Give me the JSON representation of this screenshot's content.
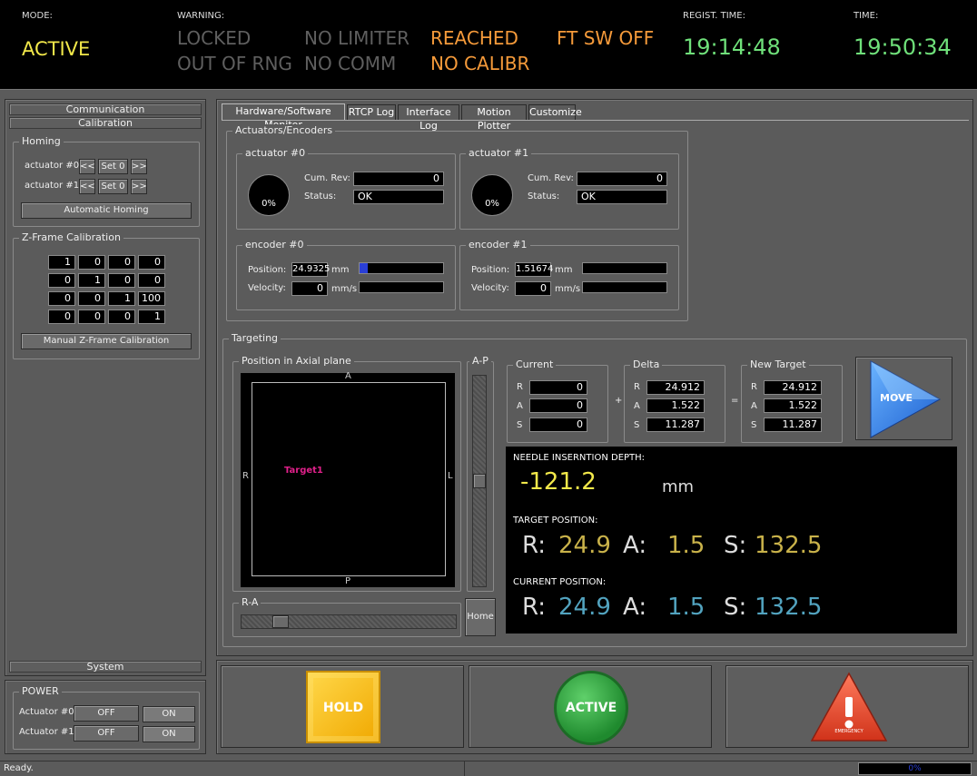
{
  "status": {
    "mode_label": "MODE:",
    "mode_value": "ACTIVE",
    "warning_label": "WARNING:",
    "warnings": {
      "locked": "LOCKED",
      "no_limiter": "NO LIMITER",
      "reached": "REACHED",
      "ft_sw_off": "FT SW OFF",
      "out_of_rng": "OUT OF RNG",
      "no_comm": "NO COMM",
      "no_calibr": "NO CALIBR"
    },
    "regist_label": "REGIST. TIME:",
    "regist_time": "19:14:48",
    "time_label": "TIME:",
    "time_value": "19:50:34"
  },
  "sidebar": {
    "communication": "Communication",
    "calibration": "Calibration",
    "homing_title": "Homing",
    "actuator0": "actuator #0",
    "actuator1": "actuator #1",
    "prev": "<<",
    "set0": "Set 0",
    "next": ">>",
    "auto_homing": "Automatic Homing",
    "zframe_title": "Z-Frame Calibration",
    "matrix": [
      [
        "1",
        "0",
        "0",
        "0"
      ],
      [
        "0",
        "1",
        "0",
        "0"
      ],
      [
        "0",
        "0",
        "1",
        "100"
      ],
      [
        "0",
        "0",
        "0",
        "1"
      ]
    ],
    "manual_zframe": "Manual Z-Frame Calibration",
    "system": "System"
  },
  "power": {
    "title": "POWER",
    "actuator0": "Actuator #0",
    "actuator1": "Actuator #1",
    "off": "OFF",
    "on": "ON"
  },
  "tabs": [
    "Hardware/Software Monitor",
    "RTCP Log",
    "Interface Log",
    "Motion Plotter",
    "Customize"
  ],
  "monitor": {
    "group_title": "Actuators/Encoders",
    "actuator0_title": "actuator #0",
    "actuator1_title": "actuator #1",
    "cum_rev_label": "Cum. Rev:",
    "status_label": "Status:",
    "dial0": "0%",
    "dial1": "0%",
    "cum_rev0": "0",
    "cum_rev1": "0",
    "status0": "OK",
    "status1": "OK",
    "encoder0_title": "encoder #0",
    "encoder1_title": "encoder #1",
    "position_label": "Position:",
    "velocity_label": "Velocity:",
    "mm": "mm",
    "mms": "mm/s",
    "pos0": "24.9325",
    "vel0": "0",
    "pos1": "1.51674",
    "vel1": "0",
    "pos0_bar_fraction": 0.1
  },
  "targeting": {
    "title": "Targeting",
    "axial_title": "Position in Axial plane",
    "ap_title": "A-P",
    "ra_title": "R-A",
    "label_a": "A",
    "label_p": "P",
    "label_r": "R",
    "label_l": "L",
    "target_label": "Target1",
    "home": "Home",
    "current_title": "Current",
    "delta_title": "Delta",
    "new_target_title": "New Target",
    "r": "R",
    "a": "A",
    "s": "S",
    "plus": "+",
    "equals": "=",
    "current": [
      "0",
      "0",
      "0"
    ],
    "delta": [
      "24.912",
      "1.522",
      "11.287"
    ],
    "new_target": [
      "24.912",
      "1.522",
      "11.287"
    ],
    "move": "MOVE"
  },
  "info": {
    "depth_label": "NEEDLE INSERNTION DEPTH:",
    "depth_value": "-121.2",
    "depth_unit": "mm",
    "target_label": "TARGET POSITION:",
    "current_label": "CURRENT POSITION:",
    "r_label": "R:",
    "a_label": "A:",
    "s_label": "S:",
    "target_r": "24.9",
    "target_a": "1.5",
    "target_s": "132.5",
    "current_r": "24.9",
    "current_a": "1.5",
    "current_s": "132.5"
  },
  "controls": {
    "hold": "HOLD",
    "active": "ACTIVE",
    "emergency": "EMERGENCY"
  },
  "statusbar": {
    "ready": "Ready.",
    "progress": "0%"
  }
}
